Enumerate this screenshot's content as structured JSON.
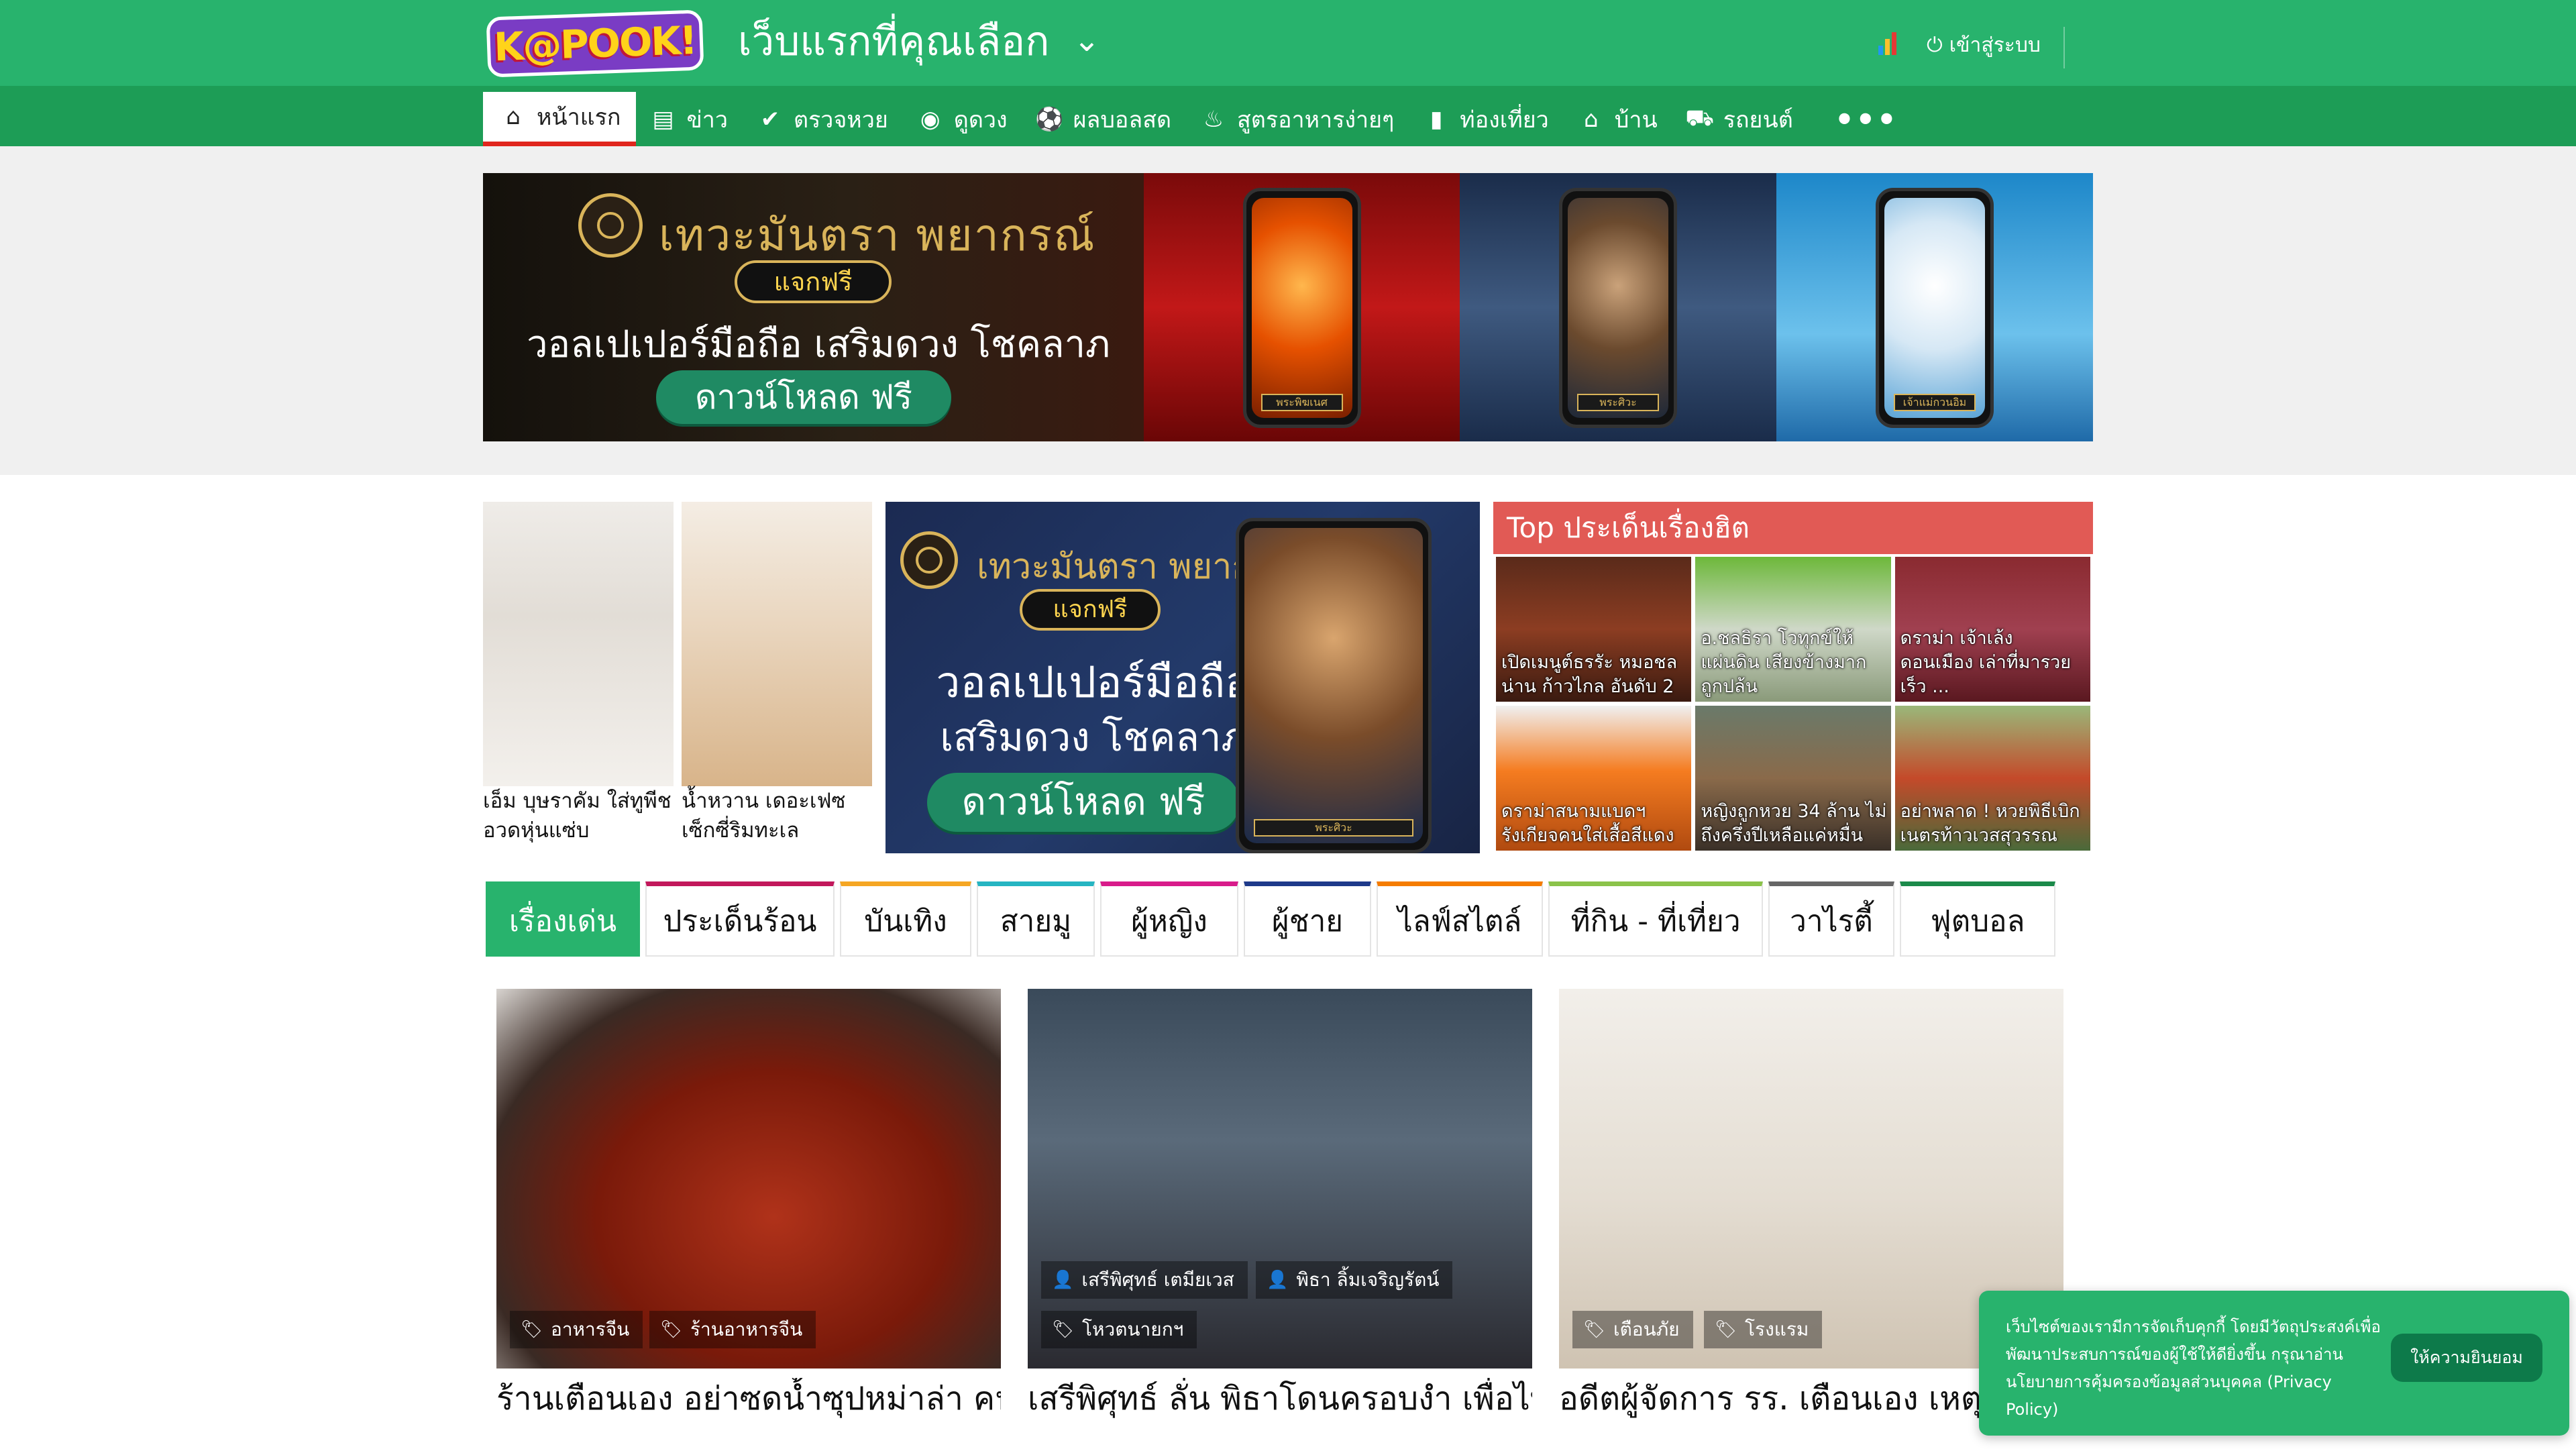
{
  "header": {
    "logo_text": "K@POOK!",
    "tagline": "เว็บแรกที่คุณเลือก",
    "login_label": "เข้าสู่ระบบ"
  },
  "nav": {
    "items": [
      {
        "label": "หน้าแรก",
        "icon": "home-icon",
        "active": true
      },
      {
        "label": "ข่าว",
        "icon": "newspaper-icon"
      },
      {
        "label": "ตรวจหวย",
        "icon": "check-circle-icon"
      },
      {
        "label": "ดูดวง",
        "icon": "eye-icon"
      },
      {
        "label": "ผลบอลสด",
        "icon": "soccer-ball-icon"
      },
      {
        "label": "สูตรอาหารง่ายๆ",
        "icon": "chef-hat-icon"
      },
      {
        "label": "ท่องเที่ยว",
        "icon": "luggage-icon"
      },
      {
        "label": "บ้าน",
        "icon": "house-icon"
      },
      {
        "label": "รถยนต์",
        "icon": "car-icon"
      }
    ],
    "more_label": "•••"
  },
  "top_ad": {
    "brand": "เทวะมันตรา พยากรณ์",
    "pill": "แจกฟรี",
    "headline": "วอลเปเปอร์มือถือ เสริมดวง โชคลาภ",
    "button": "ดาวน์โหลด ฟรี",
    "phone_labels": [
      "พระพิฆเนศ",
      "พระศิวะ",
      "เจ้าแม่กวนอิม"
    ]
  },
  "featured": [
    {
      "caption": "เอ็ม บุษราคัม ใส่ทูพีช อวดหุ่นแซ่บ"
    },
    {
      "caption": "น้ำหวาน เดอะเฟซ เซ็กซี่ริมทะเล"
    }
  ],
  "mid_ad": {
    "brand": "เทวะมันตรา พยากรณ์",
    "pill": "แจกฟรี",
    "headline_1": "วอลเปเปอร์มือถือ",
    "headline_2": "เสริมดวง โชคลาภ",
    "button": "ดาวน์โหลด ฟรี",
    "phone_label": "พระศิวะ"
  },
  "top_issues": {
    "header": "Top ประเด็นเรื่องฮิต",
    "items": [
      {
        "caption": "เปิดเมนูต์ธรรัะ หมอชลน่าน ก้าวไกล อันดับ 2"
      },
      {
        "caption": "อ.ชลธิรา โวทุกข์ให้แผ่นดิน เสียงข้างมากถูกปล้น"
      },
      {
        "caption": "ดราม่า เจ้าเล้ง ดอนเมือง เล่าที่มารวยเร็ว ..."
      },
      {
        "caption": "ดราม่าสนามแบดฯ รังเกียจคนใส่เสื้อสีแดง"
      },
      {
        "caption": "หญิงถูกหวย 34 ล้าน ไม่ถึงครึ่งปีเหลือแค่หมื่น"
      },
      {
        "caption": "อย่าพลาด ! หวยพิธีเบิกเนตรท้าวเวสสุวรรณ"
      }
    ]
  },
  "category_tabs": [
    {
      "label": "เรื่องเด่น",
      "color": "#28b36d",
      "active": true
    },
    {
      "label": "ประเด็นร้อน",
      "color": "#c2185b"
    },
    {
      "label": "บันเทิง",
      "color": "#f5a623"
    },
    {
      "label": "สายมู",
      "color": "#26b5c2"
    },
    {
      "label": "ผู้หญิง",
      "color": "#d81b8a"
    },
    {
      "label": "ผู้ชาย",
      "color": "#1e3a8a"
    },
    {
      "label": "ไลฟ์สไตล์",
      "color": "#f57c00"
    },
    {
      "label": "ที่กิน - ที่เที่ยว",
      "color": "#8bc34a"
    },
    {
      "label": "วาไรตี้",
      "color": "#666666"
    },
    {
      "label": "ฟุตบอล",
      "color": "#1b8a4a"
    }
  ],
  "articles": [
    {
      "title": "ร้านเตือนเอง อย่าซดน้ำซุปหม่าล่า คนจีนไม่มีใครทำ เผยมีอะไรในนั้น",
      "tags": [
        "อาหารจีน",
        "ร้านอาหารจีน"
      ]
    },
    {
      "title": "เสรีพิศุทธ์ ลั่น พิธาโดนครอบงำ เพื่อไทยไม่จำเป็นต้องทำตาม MOU และจะขอเลือกต่อ",
      "people": [
        "เสรีพิศุทธ์ เตมียเวส",
        "พิธา ลิ้มเจริญรัตน์"
      ],
      "tags": [
        "โหวตนายกฯ"
      ]
    },
    {
      "title": "อดีตผู้จัดการ รร. เตือนเอง เหตุที่ไม่แปรงสีฟันไว้ รู้แล้วอึ้ย",
      "tags": [
        "เตือนภัย",
        "โรงแรม"
      ]
    }
  ],
  "consent": {
    "message": "เว็บไซต์ของเรามีการจัดเก็บคุกกี้ โดยมีวัตถุประสงค์เพื่อพัฒนาประสบการณ์ของผู้ใช้ให้ดียิ่งขึ้น กรุณาอ่านนโยบายการคุ้มครองข้อมูลส่วนบุคคล (Privacy Policy)",
    "accept": "ให้ความยินยอม"
  },
  "colors": {
    "brand_green": "#28b36d",
    "nav_green": "#1d9d56",
    "accent_red": "#e0261d",
    "top_header": "#e15a55"
  }
}
